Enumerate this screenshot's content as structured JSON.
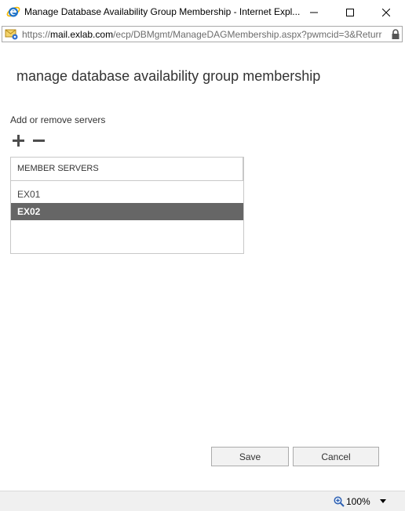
{
  "window": {
    "title": "Manage Database Availability Group Membership - Internet Expl..."
  },
  "addressbar": {
    "url_prefix": "https://",
    "url_domain": "mail.exlab.com",
    "url_path": "/ecp/DBMgmt/ManageDAGMembership.aspx?pwmcid=3&Returr"
  },
  "page": {
    "title": "manage database availability group membership",
    "section_label": "Add or remove servers"
  },
  "toolbar": {
    "icons": [
      "plus-icon",
      "minus-icon"
    ]
  },
  "member_servers": {
    "header": "MEMBER SERVERS",
    "rows": [
      {
        "name": "EX01",
        "selected": false
      },
      {
        "name": "EX02",
        "selected": true
      }
    ]
  },
  "buttons": {
    "save": "Save",
    "cancel": "Cancel"
  },
  "statusbar": {
    "zoom": "100%"
  },
  "colors": {
    "selected_row_bg": "#666666",
    "ie_blue": "#1e73c8",
    "ie_ring": "#f5b800"
  }
}
